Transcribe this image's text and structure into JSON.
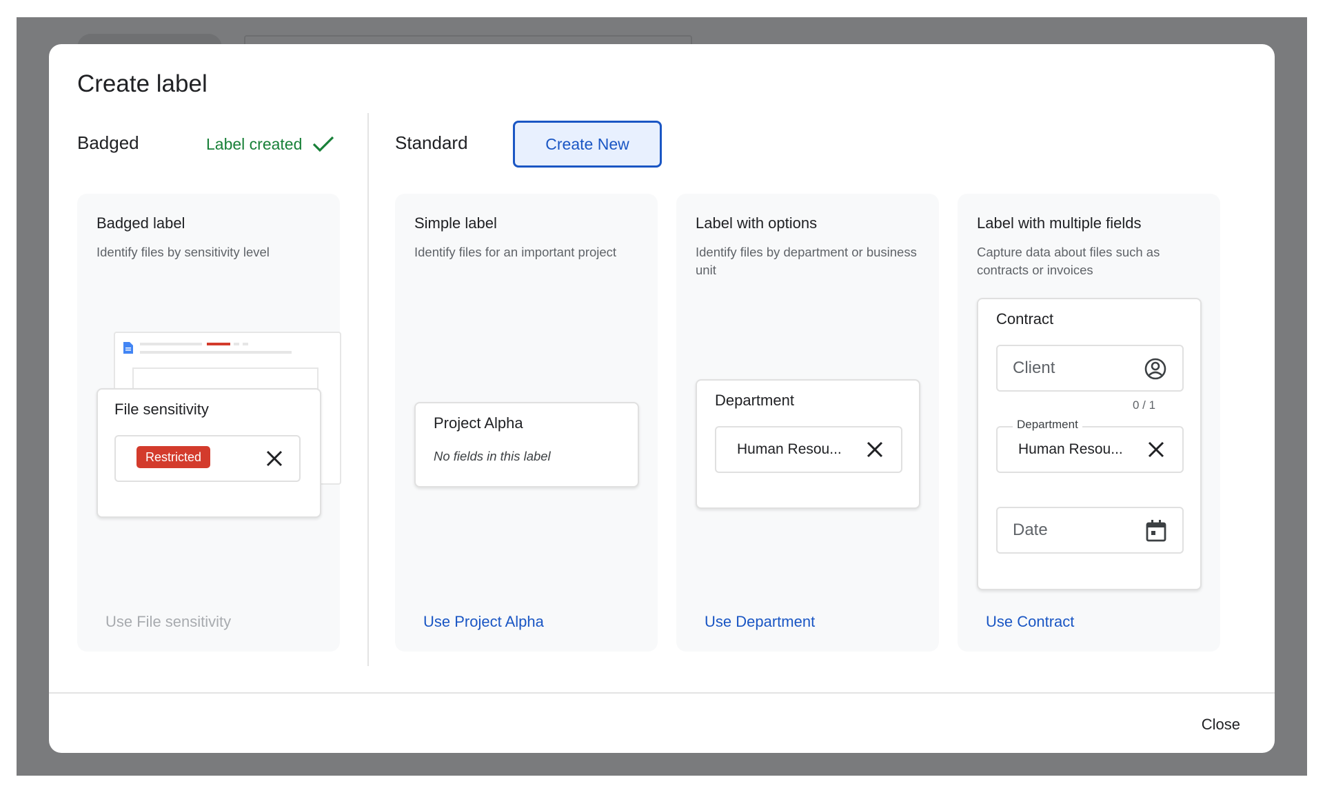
{
  "dialog": {
    "title": "Create label",
    "close_label": "Close"
  },
  "badged": {
    "heading": "Badged",
    "status": "Label created",
    "card": {
      "title": "Badged label",
      "description": "Identify files by sensitivity level",
      "preview_title": "File sensitivity",
      "badge": "Restricted",
      "use_label": "Use File sensitivity"
    }
  },
  "standard": {
    "heading": "Standard",
    "create_button": "Create New",
    "cards": [
      {
        "title": "Simple label",
        "description": "Identify files for an important project",
        "preview_title": "Project Alpha",
        "preview_note": "No fields in this label",
        "use_label": "Use Project Alpha"
      },
      {
        "title": "Label with options",
        "description": "Identify files by department or business unit",
        "preview_title": "Department",
        "field_value": "Human Resou...",
        "use_label": "Use Department"
      },
      {
        "title": "Label with multiple fields",
        "description": "Capture data about files such as contracts or invoices",
        "preview_title": "Contract",
        "client_placeholder": "Client",
        "counter": "0 / 1",
        "department_label": "Department",
        "department_value": "Human Resou...",
        "date_placeholder": "Date",
        "use_label": "Use Contract"
      }
    ]
  },
  "colors": {
    "accent": "#1a56c4",
    "success": "#188038",
    "badge_red": "#d33b2c",
    "overlay": "#7a7b7d"
  }
}
